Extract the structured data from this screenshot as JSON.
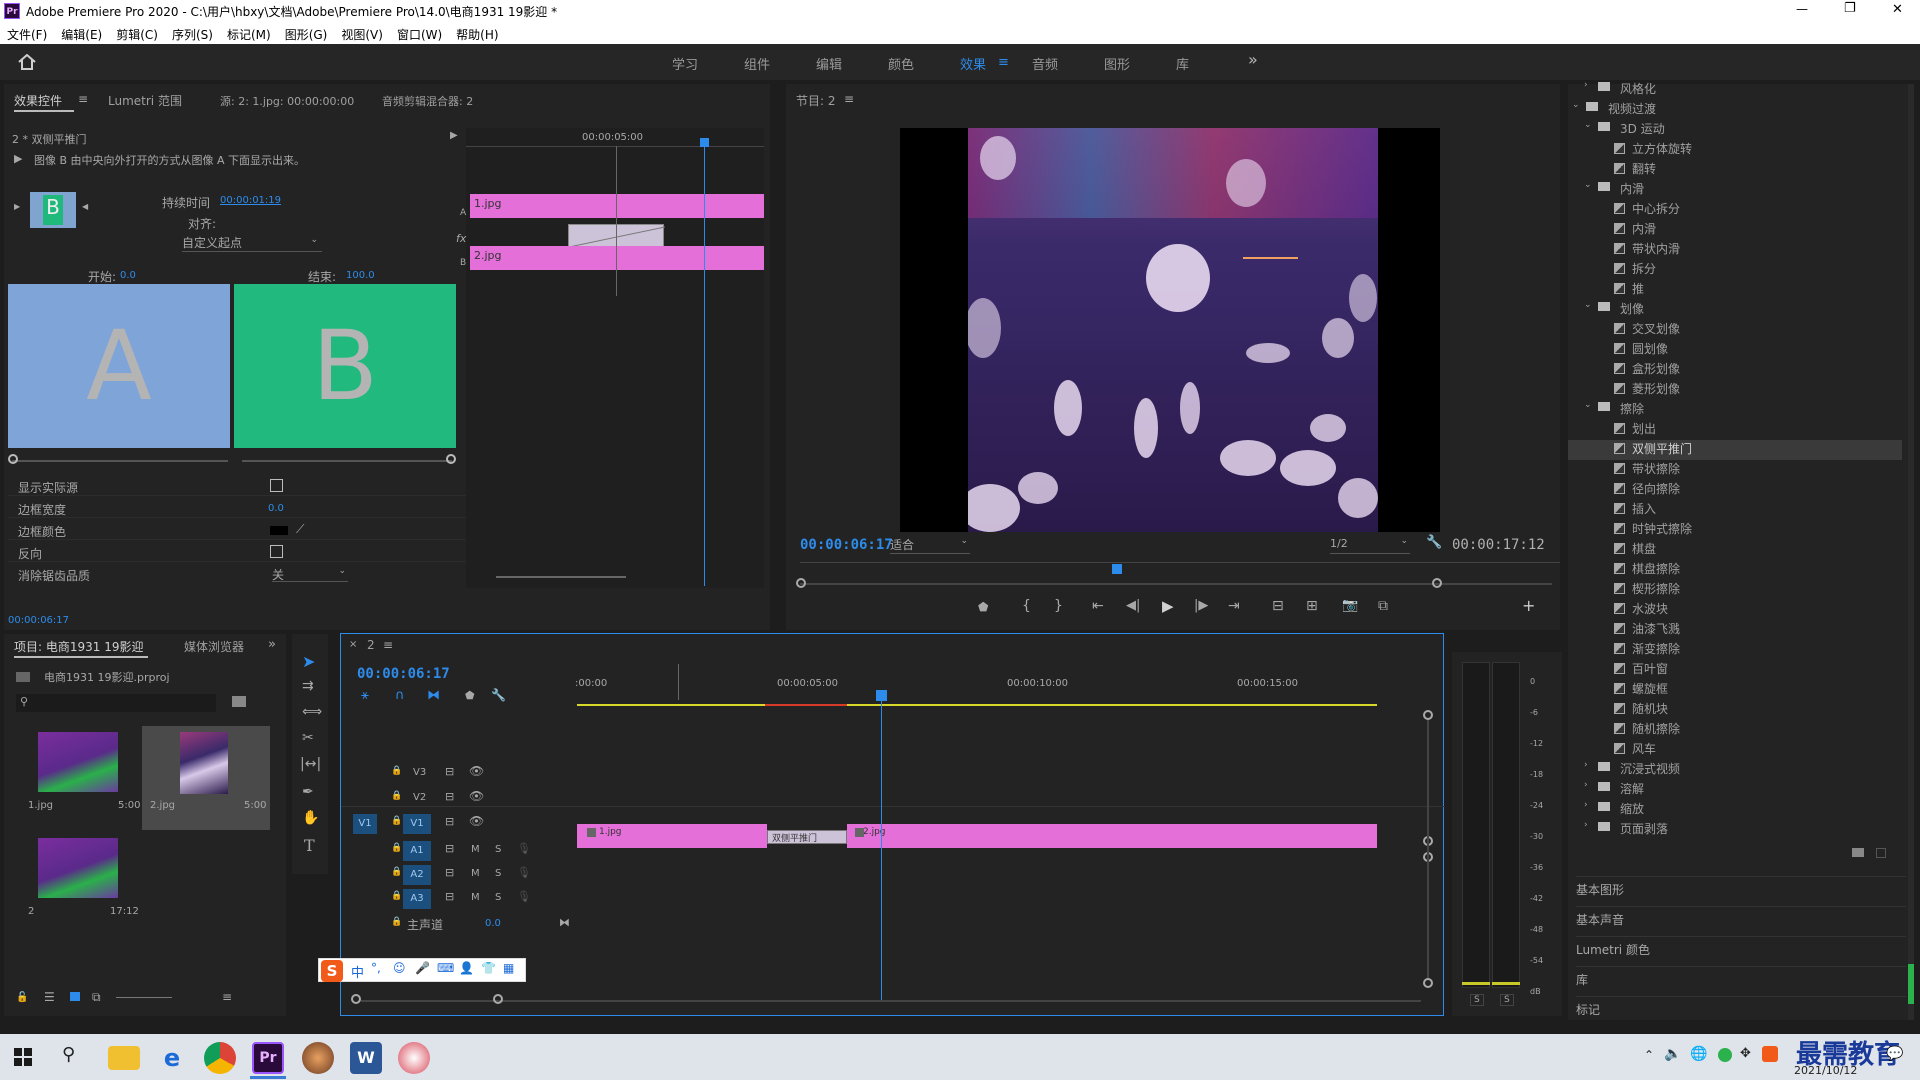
{
  "window": {
    "app_icon": "Pr",
    "title": "Adobe Premiere Pro 2020 - C:\\用户\\hbxy\\文档\\Adobe\\Premiere Pro\\14.0\\电商1931 19影迎 *",
    "minimize": "—",
    "maximize": "❐",
    "close": "✕"
  },
  "menu": [
    "文件(F)",
    "编辑(E)",
    "剪辑(C)",
    "序列(S)",
    "标记(M)",
    "图形(G)",
    "视图(V)",
    "窗口(W)",
    "帮助(H)"
  ],
  "workspaces": {
    "items": [
      "学习",
      "组件",
      "编辑",
      "颜色",
      "效果",
      "音频",
      "图形",
      "库"
    ],
    "active": "效果",
    "more": "»"
  },
  "effect_controls": {
    "tabs": [
      "效果控件",
      "Lumetri 范围",
      "源: 2: 1.jpg: 00:00:00:00",
      "音频剪辑混合器: 2"
    ],
    "transition_name": "2 * 双侧平推门",
    "description": "图像 B 由中央向外打开的方式从图像 A 下面显示出来。",
    "duration_label": "持续时间",
    "duration_value": "00:00:01:19",
    "align_label": "对齐:",
    "align_value": "自定义起点",
    "start_label": "开始:",
    "start_value": "0.0",
    "end_label": "结束:",
    "end_value": "100.0",
    "thumb_a": "A",
    "thumb_b": "B",
    "mini_b": "B",
    "props": [
      {
        "label": "显示实际源",
        "type": "checkbox"
      },
      {
        "label": "边框宽度",
        "type": "value",
        "value": "0.0"
      },
      {
        "label": "边框颜色",
        "type": "color"
      },
      {
        "label": "反向",
        "type": "checkbox"
      },
      {
        "label": "消除锯齿品质",
        "type": "select",
        "value": "关"
      }
    ],
    "timecode": "00:00:06:17",
    "mini_timeline": {
      "ruler": "00:00:05:00",
      "clip_a": "1.jpg",
      "clip_b": "2.jpg",
      "label_a": "A",
      "label_b": "B",
      "fx": "fx"
    }
  },
  "program": {
    "title": "节目: 2",
    "timecode": "00:00:06:17",
    "fit": "适合",
    "resolution": "1/2",
    "duration": "00:00:17:12"
  },
  "effects_tree": [
    {
      "level": 1,
      "type": "folder",
      "label": "风格化",
      "open": false
    },
    {
      "level": 0,
      "type": "folder",
      "label": "视频过渡",
      "open": true
    },
    {
      "level": 1,
      "type": "folder",
      "label": "3D 运动",
      "open": true
    },
    {
      "level": 2,
      "type": "item",
      "label": "立方体旋转"
    },
    {
      "level": 2,
      "type": "item",
      "label": "翻转"
    },
    {
      "level": 1,
      "type": "folder",
      "label": "内滑",
      "open": true
    },
    {
      "level": 2,
      "type": "item",
      "label": "中心拆分"
    },
    {
      "level": 2,
      "type": "item",
      "label": "内滑"
    },
    {
      "level": 2,
      "type": "item",
      "label": "带状内滑"
    },
    {
      "level": 2,
      "type": "item",
      "label": "拆分"
    },
    {
      "level": 2,
      "type": "item",
      "label": "推"
    },
    {
      "level": 1,
      "type": "folder",
      "label": "划像",
      "open": true
    },
    {
      "level": 2,
      "type": "item",
      "label": "交叉划像"
    },
    {
      "level": 2,
      "type": "item",
      "label": "圆划像"
    },
    {
      "level": 2,
      "type": "item",
      "label": "盒形划像"
    },
    {
      "level": 2,
      "type": "item",
      "label": "菱形划像"
    },
    {
      "level": 1,
      "type": "folder",
      "label": "擦除",
      "open": true
    },
    {
      "level": 2,
      "type": "item",
      "label": "划出"
    },
    {
      "level": 2,
      "type": "item",
      "label": "双侧平推门",
      "selected": true
    },
    {
      "level": 2,
      "type": "item",
      "label": "带状擦除"
    },
    {
      "level": 2,
      "type": "item",
      "label": "径向擦除"
    },
    {
      "level": 2,
      "type": "item",
      "label": "插入"
    },
    {
      "level": 2,
      "type": "item",
      "label": "时钟式擦除"
    },
    {
      "level": 2,
      "type": "item",
      "label": "棋盘"
    },
    {
      "level": 2,
      "type": "item",
      "label": "棋盘擦除"
    },
    {
      "level": 2,
      "type": "item",
      "label": "楔形擦除"
    },
    {
      "level": 2,
      "type": "item",
      "label": "水波块"
    },
    {
      "level": 2,
      "type": "item",
      "label": "油漆飞溅"
    },
    {
      "level": 2,
      "type": "item",
      "label": "渐变擦除"
    },
    {
      "level": 2,
      "type": "item",
      "label": "百叶窗"
    },
    {
      "level": 2,
      "type": "item",
      "label": "螺旋框"
    },
    {
      "level": 2,
      "type": "item",
      "label": "随机块"
    },
    {
      "level": 2,
      "type": "item",
      "label": "随机擦除"
    },
    {
      "level": 2,
      "type": "item",
      "label": "风车"
    },
    {
      "level": 1,
      "type": "folder",
      "label": "沉浸式视频",
      "open": false
    },
    {
      "level": 1,
      "type": "folder",
      "label": "溶解",
      "open": false
    },
    {
      "level": 1,
      "type": "folder",
      "label": "缩放",
      "open": false
    },
    {
      "level": 1,
      "type": "folder",
      "label": "页面剥落",
      "open": false
    }
  ],
  "side_panels": [
    "基本图形",
    "基本声音",
    "Lumetri 颜色",
    "库",
    "标记"
  ],
  "project": {
    "tabs": [
      "项目: 电商1931 19影迎",
      "媒体浏览器"
    ],
    "file": "电商1931 19影迎.prproj",
    "items": [
      {
        "name": "1.jpg",
        "dur": "5:00"
      },
      {
        "name": "2.jpg",
        "dur": "5:00"
      },
      {
        "name": "2",
        "dur": "17:12"
      }
    ]
  },
  "timeline": {
    "tab": "2",
    "timecode": "00:00:06:17",
    "ruler": [
      ":00:00",
      "00:00:05:00",
      "00:00:10:00",
      "00:00:15:00"
    ],
    "video_tracks": [
      "V3",
      "V2",
      "V1"
    ],
    "audio_tracks": [
      "A1",
      "A2",
      "A3"
    ],
    "source_patch": "V1",
    "master_label": "主声道",
    "master_value": "0.0",
    "clip1": "1.jpg",
    "clip2": "2.jpg",
    "transition": "双侧平推门",
    "m": "M",
    "s": "S"
  },
  "meter": {
    "scale": [
      "0",
      "-6",
      "-12",
      "-18",
      "-24",
      "-30",
      "-36",
      "-42",
      "-48",
      "-54",
      "dB"
    ],
    "solo": [
      "S",
      "S"
    ]
  },
  "taskbar": {
    "date": "2021/10/12",
    "watermark": "最需教育"
  },
  "ime": {
    "logo": "S",
    "lang": "中"
  }
}
